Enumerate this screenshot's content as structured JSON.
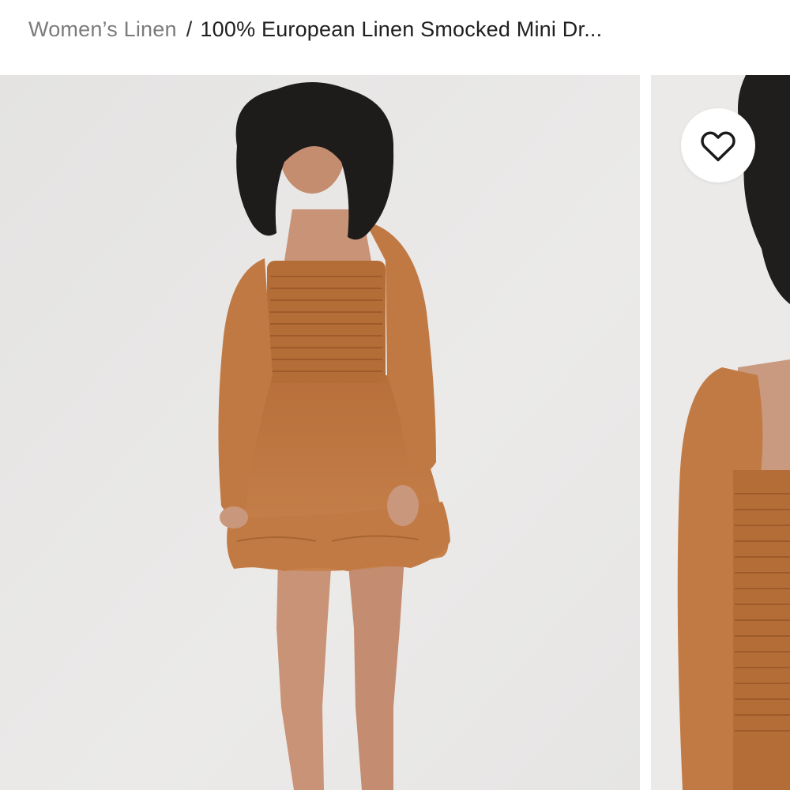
{
  "breadcrumb": {
    "parent_label": "Women’s Linen",
    "separator": "/",
    "current_label": "100% European Linen Smocked Mini Dr..."
  },
  "gallery": {
    "images": [
      {
        "name": "main-product-photo",
        "subject": "model wearing smocked mini dress"
      },
      {
        "name": "detail-product-photo",
        "subject": "close-up of smocked bodice"
      }
    ]
  },
  "favorite": {
    "icon": "heart-icon"
  },
  "colors": {
    "background": "#ffffff",
    "photo_background": "#e8e7e6",
    "dress": "#c27a44",
    "breadcrumb_muted": "#7b7b7b",
    "breadcrumb_text": "#1f1f1f"
  }
}
